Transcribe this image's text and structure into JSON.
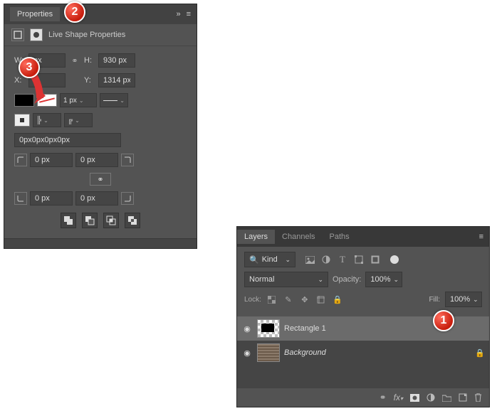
{
  "properties": {
    "title": "Properties",
    "subtitle": "Live Shape Properties",
    "w_label": "W:",
    "w_value": "px",
    "h_label": "H:",
    "h_value": "930 px",
    "x_label": "X:",
    "x_value": "",
    "y_label": "Y:",
    "y_value": "1314 px",
    "stroke_width": "1 px",
    "corner_summary": "0px0px0px0px",
    "corner_tl": "0 px",
    "corner_tr": "0 px",
    "corner_bl": "0 px",
    "corner_br": "0 px"
  },
  "layers": {
    "tabs": [
      "Layers",
      "Channels",
      "Paths"
    ],
    "kind_label": "Kind",
    "blend_mode": "Normal",
    "opacity_label": "Opacity:",
    "opacity_value": "100%",
    "lock_label": "Lock:",
    "fill_label": "Fill:",
    "fill_value": "100%",
    "items": [
      {
        "name": "Rectangle 1",
        "selected": true,
        "italic": false,
        "locked": false
      },
      {
        "name": "Background",
        "selected": false,
        "italic": true,
        "locked": true
      }
    ]
  },
  "callouts": {
    "c1": "1",
    "c2": "2",
    "c3": "3"
  },
  "icons": {
    "search": "🔍",
    "eye": "👁",
    "link": "⚭",
    "lock": "🔒",
    "menu": "≡",
    "chev": "⌄",
    "collapse": "»"
  }
}
